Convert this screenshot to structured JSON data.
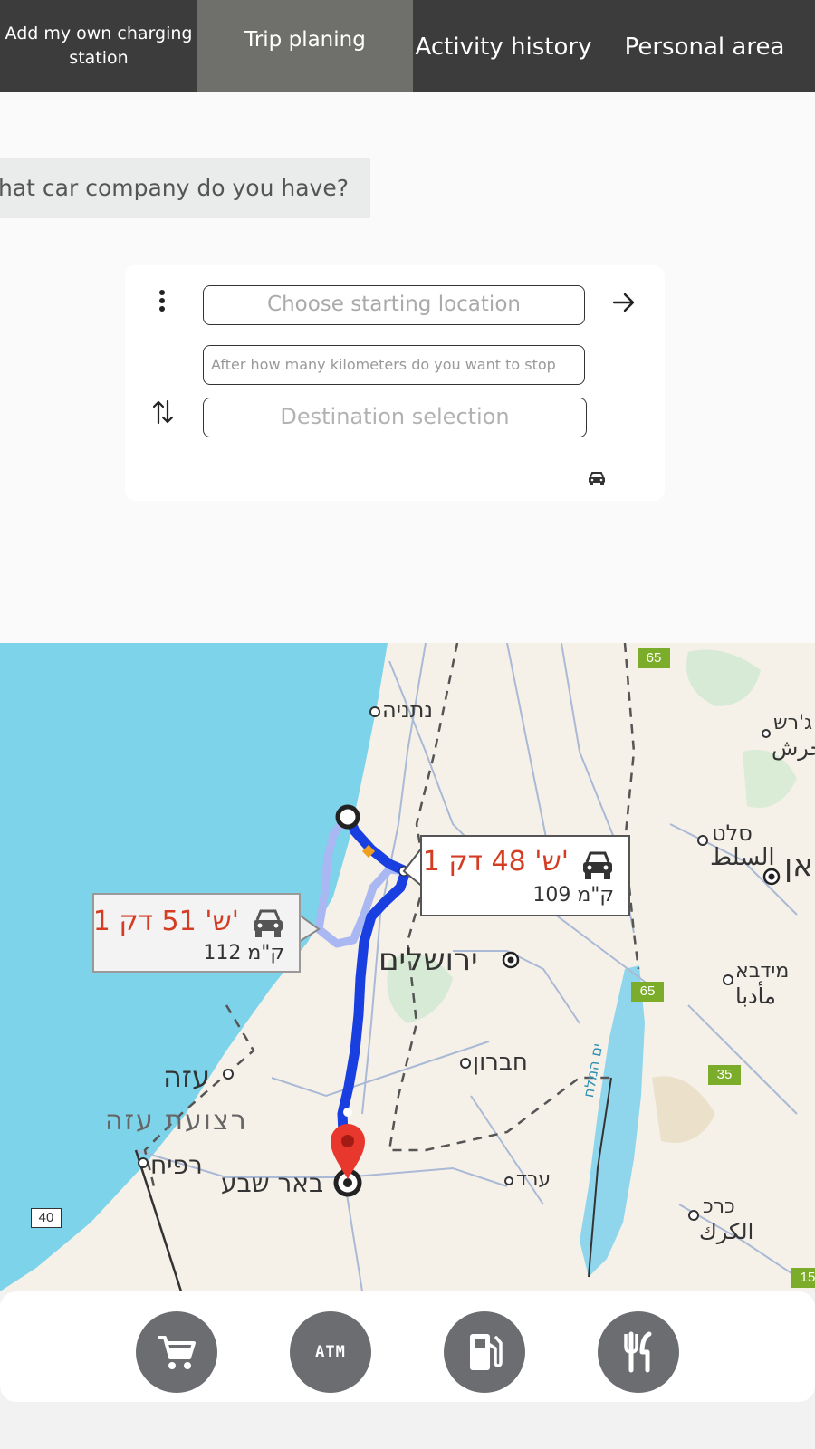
{
  "nav": {
    "tabs": [
      {
        "label": "Add my own charging station"
      },
      {
        "label": "Trip planing"
      },
      {
        "label": "Activity history"
      },
      {
        "label": "Personal area"
      }
    ],
    "active_tab": "Trip planing"
  },
  "car_question": "hat car company do you have?",
  "trip_form": {
    "start_placeholder": "Choose starting location",
    "km_placeholder": "After how many kilometers do you want to stop",
    "destination_placeholder": "Destination selection"
  },
  "map": {
    "routes": [
      {
        "time": "1 ש' 48 דק'",
        "distance": "109 ק\"מ"
      },
      {
        "time": "1 ש' 51 דק'",
        "distance": "112 ק\"מ"
      }
    ],
    "places": {
      "netanya": "נתניה",
      "jerusalem": "ירושלים",
      "hebron": "חברון",
      "gaza": "עזה",
      "gaza_strip": "רצועת עזה",
      "rafah": "רפיח",
      "beersheba": "באר שבע",
      "arad": "ערד",
      "salt": "סלט",
      "salt_ar": "السلط",
      "madaba": "מידבא",
      "madaba_ar": "مأدبا",
      "karak": "כרכ",
      "karak_ar": "الكرك",
      "jerash": "ג'רש",
      "jerash_ar": "جرش",
      "amman_partial": "אן",
      "dead_sea": "ים המלח"
    },
    "shields": {
      "r65a": "65",
      "r65b": "65",
      "r35": "35",
      "r40": "40",
      "r15": "15"
    }
  },
  "amenities": [
    {
      "name": "shopping-cart-icon"
    },
    {
      "name": "atm-icon",
      "label": "ATM"
    },
    {
      "name": "fuel-pump-icon"
    },
    {
      "name": "restaurant-icon"
    }
  ],
  "colors": {
    "nav_bg": "#3c3c3c",
    "nav_active": "#6f6f6b",
    "route_primary": "#1a3fe0",
    "route_alt": "#a9b7f2",
    "time_text": "#d43d24",
    "sea": "#7dd3ea",
    "amenity_circle": "#6b6d70"
  }
}
